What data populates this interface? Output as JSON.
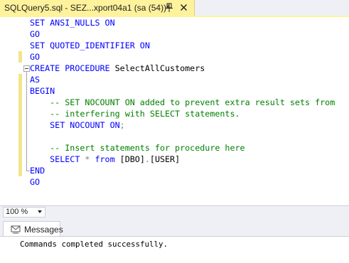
{
  "tab": {
    "title": "SQLQuery5.sql - SEZ...xport04a1 (sa (54))*"
  },
  "icons": {
    "pin": "pin-icon",
    "close": "close-icon",
    "messages": "messages-icon"
  },
  "colors": {
    "tab_active": "#fff29d",
    "keyword": "#0000ff",
    "comment": "#008000",
    "operator": "#808080",
    "change_marker": "#f1e58c"
  },
  "editor": {
    "lines": [
      [
        {
          "t": "SET ANSI_NULLS ON",
          "c": "kw"
        }
      ],
      [
        {
          "t": "GO",
          "c": "kw"
        }
      ],
      [
        {
          "t": "SET QUOTED_IDENTIFIER ON",
          "c": "kw"
        }
      ],
      [
        {
          "t": "GO",
          "c": "kw"
        }
      ],
      [
        {
          "t": "CREATE PROCEDURE ",
          "c": "kw"
        },
        {
          "t": "SelectAllCustomers",
          "c": "tx"
        }
      ],
      [
        {
          "t": "AS",
          "c": "kw"
        }
      ],
      [
        {
          "t": "BEGIN",
          "c": "kw"
        }
      ],
      [
        {
          "t": "    -- SET NOCOUNT ON added to prevent extra result sets from",
          "c": "cm"
        }
      ],
      [
        {
          "t": "    -- interfering with SELECT statements.",
          "c": "cm"
        }
      ],
      [
        {
          "t": "    SET NOCOUNT ON",
          "c": "kw"
        },
        {
          "t": ";",
          "c": "op"
        }
      ],
      [
        {
          "t": "",
          "c": "tx"
        }
      ],
      [
        {
          "t": "    -- Insert statements for procedure here",
          "c": "cm"
        }
      ],
      [
        {
          "t": "    SELECT ",
          "c": "kw"
        },
        {
          "t": "* ",
          "c": "op"
        },
        {
          "t": "from ",
          "c": "kw"
        },
        {
          "t": "[DBO]",
          "c": "tx"
        },
        {
          "t": ".",
          "c": "op"
        },
        {
          "t": "[USER]",
          "c": "tx"
        }
      ],
      [
        {
          "t": "END",
          "c": "kw"
        }
      ],
      [
        {
          "t": "GO",
          "c": "kw"
        }
      ]
    ],
    "changed_lines": [
      3,
      5,
      6,
      7,
      8,
      9,
      10,
      11,
      12,
      13
    ]
  },
  "zoom": {
    "value": "100 %"
  },
  "results": {
    "tab_label": "Messages",
    "message": "Commands completed successfully."
  }
}
